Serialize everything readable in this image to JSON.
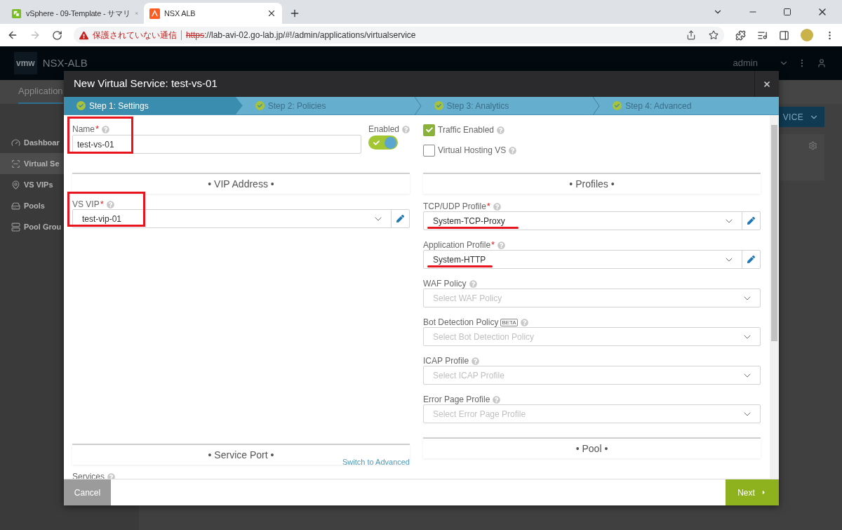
{
  "browser": {
    "tabs": [
      {
        "title": "vSphere - 09-Template - サマリ",
        "selected": false,
        "kind": "vsphere"
      },
      {
        "title": "NSX ALB",
        "selected": true,
        "kind": "alb"
      }
    ],
    "security_warning": "保護されていない通信",
    "url_scheme": "https",
    "url_rest": "://lab-avi-02.go-lab.jp/#!/admin/applications/virtualservice"
  },
  "app_header": {
    "logo": "vmw",
    "product": "NSX-ALB",
    "user": "admin"
  },
  "background": {
    "nav_tab": "Application",
    "action_button": "VICE",
    "sidebar": [
      {
        "label": "Dashboar",
        "kind": "dashboard",
        "selected": false
      },
      {
        "label": "Virtual Se",
        "kind": "virtual-service",
        "selected": true
      },
      {
        "label": "VS VIPs",
        "kind": "pin",
        "selected": false
      },
      {
        "label": "Pools",
        "kind": "pool",
        "selected": false
      },
      {
        "label": "Pool Grou",
        "kind": "pool-group",
        "selected": false
      }
    ]
  },
  "modal": {
    "title": "New Virtual Service: test-vs-01",
    "steps": [
      {
        "label": "Step 1: Settings",
        "selected": true,
        "done": true
      },
      {
        "label": "Step 2: Policies",
        "selected": false,
        "done": true
      },
      {
        "label": "Step 3: Analytics",
        "selected": false,
        "done": true
      },
      {
        "label": "Step 4: Advanced",
        "selected": false,
        "done": true
      }
    ],
    "name_field": {
      "label": "Name",
      "required_mark": "*",
      "value": "test-vs-01",
      "highlighted": true
    },
    "enabled": {
      "label": "Enabled",
      "on": true
    },
    "vip_section": "• VIP Address •",
    "vs_vip": {
      "label": "VS VIP",
      "required_mark": "*",
      "value": "test-vip-01",
      "highlighted": true
    },
    "service_port_section": "• Service Port •",
    "switch_link": "Switch to Advanced",
    "services_label": "Services",
    "options": [
      {
        "label": "Traffic Enabled",
        "checked": true
      },
      {
        "label": "Virtual Hosting VS",
        "checked": false
      }
    ],
    "profiles_section": "• Profiles •",
    "profile_fields": [
      {
        "label": "TCP/UDP Profile",
        "required_mark": "*",
        "value": "System-TCP-Proxy",
        "editable": true,
        "underlined": true
      },
      {
        "label": "Application Profile",
        "required_mark": "*",
        "value": "System-HTTP",
        "editable": true,
        "underlined": true
      },
      {
        "label": "WAF Policy",
        "placeholder": "Select WAF Policy",
        "editable": false,
        "underlined": false
      },
      {
        "label": "Bot Detection Policy",
        "badge": "BETA",
        "placeholder": "Select Bot Detection Policy",
        "editable": false,
        "underlined": false
      },
      {
        "label": "ICAP Profile",
        "placeholder": "Select ICAP Profile",
        "editable": false,
        "underlined": false
      },
      {
        "label": "Error Page Profile",
        "placeholder": "Select Error Page Profile",
        "editable": false,
        "underlined": false
      }
    ],
    "pool_section": "• Pool •",
    "cancel": "Cancel",
    "next": "Next"
  }
}
